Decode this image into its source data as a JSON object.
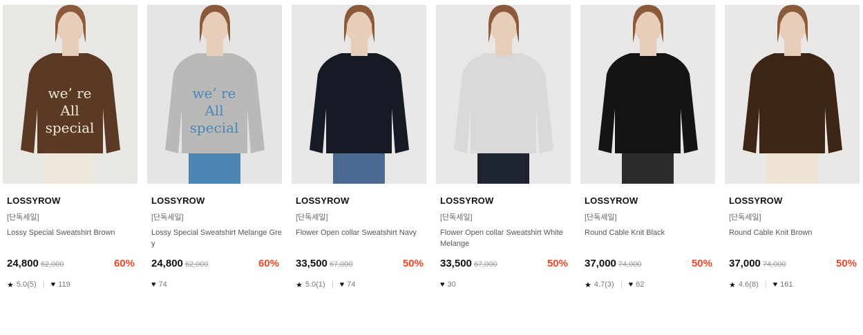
{
  "products": [
    {
      "brand": "LOSSYROW",
      "tag": "[단독세일]",
      "name": "Lossy Special Sweatshirt Brown",
      "price": "24,800",
      "original_price": "62,000",
      "discount": "60%",
      "rating": "5.0(5)",
      "likes": "119",
      "image": {
        "bg": "#e9e7e4",
        "top": "#5a3a24",
        "bottom": "#eee8dc",
        "print": "we're All special",
        "print_color": "#efe7d8"
      }
    },
    {
      "brand": "LOSSYROW",
      "tag": "[단독세일]",
      "name": "Lossy Special Sweatshirt Melange Grey",
      "price": "24,800",
      "original_price": "62,000",
      "discount": "60%",
      "rating": null,
      "likes": "74",
      "image": {
        "bg": "#e6e5e3",
        "top": "#b9b9b8",
        "bottom": "#4d86b4",
        "print": "we're All special",
        "print_color": "#4b86b7"
      }
    },
    {
      "brand": "LOSSYROW",
      "tag": "[단독세일]",
      "name": "Flower Open collar Sweatshirt Navy",
      "price": "33,500",
      "original_price": "67,000",
      "discount": "50%",
      "rating": "5.0(1)",
      "likes": "74",
      "image": {
        "bg": "#e8e7e5",
        "top": "#151a24",
        "bottom": "#4a6a92",
        "print": "",
        "print_color": ""
      }
    },
    {
      "brand": "LOSSYROW",
      "tag": "[단독세일]",
      "name": "Flower Open collar Sweatshirt White Melange",
      "price": "33,500",
      "original_price": "67,000",
      "discount": "50%",
      "rating": null,
      "likes": "30",
      "image": {
        "bg": "#e8e7e6",
        "top": "#d9d9dc",
        "bottom": "#1e2330",
        "print": "",
        "print_color": ""
      }
    },
    {
      "brand": "LOSSYROW",
      "tag": "[단독세일]",
      "name": "Round Cable Knit Black",
      "price": "37,000",
      "original_price": "74,000",
      "discount": "50%",
      "rating": "4.7(3)",
      "likes": "62",
      "image": {
        "bg": "#e9e8e6",
        "top": "#141414",
        "bottom": "#2b2b2b",
        "print": "",
        "print_color": ""
      }
    },
    {
      "brand": "LOSSYROW",
      "tag": "[단독세일]",
      "name": "Round Cable Knit Brown",
      "price": "37,000",
      "original_price": "74,000",
      "discount": "50%",
      "rating": "4.6(8)",
      "likes": "161",
      "image": {
        "bg": "#e9e8e6",
        "top": "#3d2616",
        "bottom": "#ece3d2",
        "print": "",
        "print_color": ""
      }
    }
  ]
}
